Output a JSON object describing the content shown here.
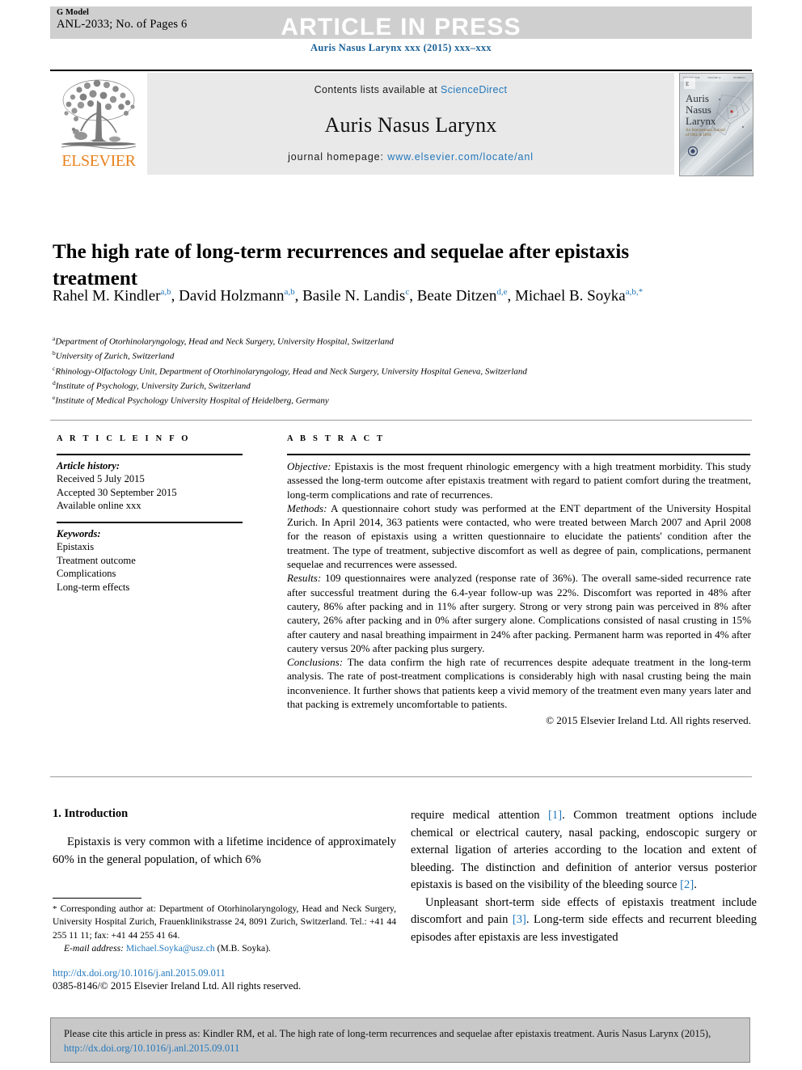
{
  "header": {
    "g_model": "G Model",
    "article_id": "ANL-2033; No. of Pages 6",
    "banner": "ARTICLE IN PRESS",
    "journal_ref": "Auris Nasus Larynx xxx (2015) xxx–xxx"
  },
  "masthead": {
    "elsevier_label": "ELSEVIER",
    "contents_prefix": "Contents lists available at ",
    "sciencedirect": "ScienceDirect",
    "journal_name": "Auris Nasus Larynx",
    "homepage_prefix": "journal homepage: ",
    "homepage_url": "www.elsevier.com/locate/anl",
    "cover": {
      "line1": "Auris",
      "line2": "Nasus",
      "line3": "Larynx",
      "subtitle": "An International Journal of ORL & HNS"
    }
  },
  "article": {
    "title": "The high rate of long-term recurrences and sequelae after epistaxis treatment",
    "authors": [
      {
        "name": "Rahel M. Kindler",
        "sup": "a,b",
        "sep": ", "
      },
      {
        "name": "David Holzmann",
        "sup": "a,b",
        "sep": ", "
      },
      {
        "name": "Basile N. Landis",
        "sup": "c",
        "sep": ", "
      },
      {
        "name": "Beate Ditzen",
        "sup": "d,e",
        "sep": ","
      },
      {
        "name": "Michael B. Soyka",
        "sup": "a,b,*",
        "sep": ""
      }
    ],
    "affiliations": [
      {
        "marker": "a",
        "text": "Department of Otorhinolaryngology, Head and Neck Surgery, University Hospital, Switzerland"
      },
      {
        "marker": "b",
        "text": "University of Zurich, Switzerland"
      },
      {
        "marker": "c",
        "text": "Rhinology-Olfactology Unit, Department of Otorhinolaryngology, Head and Neck Surgery, University Hospital Geneva, Switzerland"
      },
      {
        "marker": "d",
        "text": "Institute of Psychology, University Zurich, Switzerland"
      },
      {
        "marker": "e",
        "text": "Institute of Medical Psychology University Hospital of Heidelberg, Germany"
      }
    ]
  },
  "article_info": {
    "heading": "A R T I C L E   I N F O",
    "history_label": "Article history:",
    "history": [
      "Received 5 July 2015",
      "Accepted 30 September 2015",
      "Available online xxx"
    ],
    "keywords_label": "Keywords:",
    "keywords": [
      "Epistaxis",
      "Treatment outcome",
      "Complications",
      "Long-term effects"
    ]
  },
  "abstract": {
    "heading": "A B S T R A C T",
    "objective_label": "Objective:",
    "objective": " Epistaxis is the most frequent rhinologic emergency with a high treatment morbidity. This study assessed the long-term outcome after epistaxis treatment with regard to patient comfort during the treatment, long-term complications and rate of recurrences.",
    "methods_label": "Methods:",
    "methods": " A questionnaire cohort study was performed at the ENT department of the University Hospital Zurich. In April 2014, 363 patients were contacted, who were treated between March 2007 and April 2008 for the reason of epistaxis using a written questionnaire to elucidate the patients' condition after the treatment. The type of treatment, subjective discomfort as well as degree of pain, complications, permanent sequelae and recurrences were assessed.",
    "results_label": "Results:",
    "results": " 109 questionnaires were analyzed (response rate of 36%). The overall same-sided recurrence rate after successful treatment during the 6.4-year follow-up was 22%. Discomfort was reported in 48% after cautery, 86% after packing and in 11% after surgery. Strong or very strong pain was perceived in 8% after cautery, 26% after packing and in 0% after surgery alone. Complications consisted of nasal crusting in 15% after cautery and nasal breathing impairment in 24% after packing. Permanent harm was reported in 4% after cautery versus 20% after packing plus surgery.",
    "conclusions_label": "Conclusions:",
    "conclusions": " The data confirm the high rate of recurrences despite adequate treatment in the long-term analysis. The rate of post-treatment complications is considerably high with nasal crusting being the main inconvenience. It further shows that patients keep a vivid memory of the treatment even many years later and that packing is extremely uncomfortable to patients.",
    "copyright": "© 2015 Elsevier Ireland Ltd. All rights reserved."
  },
  "body": {
    "section_heading": "1. Introduction",
    "left_p1": "Epistaxis is very common with a lifetime incidence of approximately 60% in the general population, of which 6%",
    "right_p1_a": "require medical attention ",
    "right_p1_ref": "[1]",
    "right_p1_b": ". Common treatment options include chemical or electrical cautery, nasal packing, endoscopic surgery or external ligation of arteries according to the location and extent of bleeding. The distinction and definition of anterior versus posterior epistaxis is based on the visibility of the bleeding source ",
    "right_p1_ref2": "[2]",
    "right_p1_c": ".",
    "right_p2_a": "Unpleasant short-term side effects of epistaxis treatment include discomfort and pain ",
    "right_p2_ref": "[3]",
    "right_p2_b": ". Long-term side effects and recurrent bleeding episodes after epistaxis are less investigated"
  },
  "footnote": {
    "star": "*",
    "text": " Corresponding author at: Department of Otorhinolaryngology, Head and Neck Surgery, University Hospital Zurich, Frauenklinikstrasse 24, 8091 Zurich, Switzerland. Tel.: +41 44 255 11 11; fax: +41 44 255 41 64.",
    "email_label": "E-mail address:",
    "email": "Michael.Soyka@usz.ch",
    "email_suffix": " (M.B. Soyka).",
    "doi": "http://dx.doi.org/10.1016/j.anl.2015.09.011",
    "issn": "0385-8146/© 2015 Elsevier Ireland Ltd. All rights reserved."
  },
  "cite_box": {
    "text_a": "Please cite this article in press as: Kindler RM, et al. The high rate of long-term recurrences and sequelae after epistaxis treatment. Auris Nasus Larynx (2015), ",
    "link": "http://dx.doi.org/10.1016/j.anl.2015.09.011"
  },
  "colors": {
    "link": "#2277bb",
    "journal_ref": "#1b6298",
    "banner_bg": "#cfcfcf",
    "masthead_bg": "#e9e9e9",
    "cite_bg": "#c8c8c8",
    "elsevier_orange": "#e8821e"
  }
}
